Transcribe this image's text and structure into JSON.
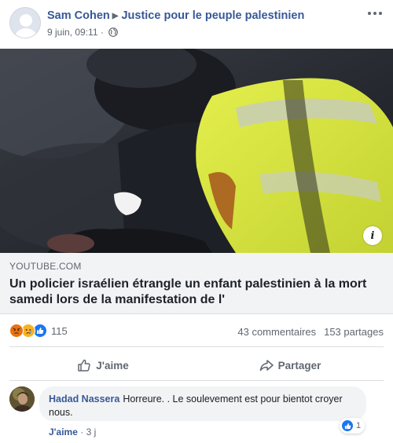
{
  "post": {
    "author": "Sam Cohen",
    "group": "Justice pour le peuple palestinien",
    "timestamp": "9 juin, 09:11",
    "separator": "·",
    "privacy_icon": "globe-icon",
    "more_icon": "more-options-icon"
  },
  "link": {
    "domain": "YOUTUBE.COM",
    "title": "Un policier israélien étrangle un enfant palestinien à la mort samedi lors de la manifestation de l'",
    "info_label": "i"
  },
  "stats": {
    "reactions": [
      "angry-reaction-icon",
      "sad-reaction-icon",
      "like-reaction-icon"
    ],
    "reaction_count": "115",
    "comments": "43 commentaires",
    "shares": "153 partages"
  },
  "actions": {
    "like": "J'aime",
    "share": "Partager"
  },
  "comment": {
    "author": "Hadad Nassera",
    "text": "Horreure. . Le soulevement est pour bientot croyer nous.",
    "reaction_count": "1",
    "like_label": "J'aime",
    "separator": "·",
    "age": "3 j"
  },
  "colors": {
    "link_blue": "#385898",
    "secondary_text": "#606770",
    "preview_bg": "#f2f3f5",
    "like_blue": "#1877f2",
    "angry_orange": "#e9710f",
    "sad_yellow": "#f7b125",
    "vest_yellow": "#d6e63a"
  }
}
